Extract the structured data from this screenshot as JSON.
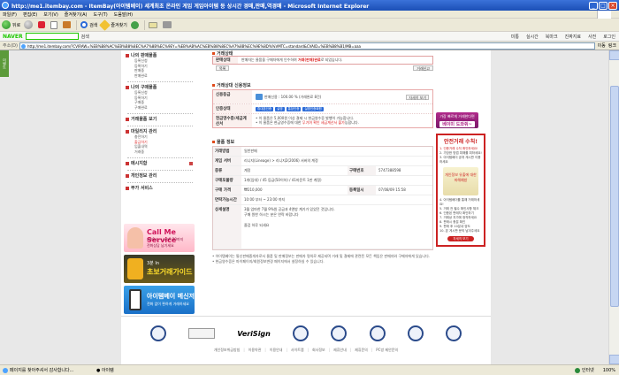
{
  "window": {
    "title": "http://me1.itembay.com - ItemBay(아이템베이) 세계최초 온라인 게임 게임아이템 등 상시간 경매,판매,역경매 - Microsoft Internet Explorer",
    "min": "_",
    "max": "□",
    "close": "×"
  },
  "menu": [
    "파일(F)",
    "편집(E)",
    "보기(V)",
    "즐겨찾기(A)",
    "도구(T)",
    "도움말(H)"
  ],
  "toolbar": {
    "back": "뒤로",
    "search": "검색",
    "favorites": "즐겨찾기"
  },
  "naver": {
    "logo": "NAVER",
    "search_btn": "검색",
    "items": [
      "미통",
      "실시간",
      "북마크",
      "진짜지료",
      "사전"
    ],
    "login": "로그인"
  },
  "address": {
    "label": "주소(D)",
    "url": "http://me1.itembay.com/?CVIRAW=%EB%B8%AC%EB%B8%8EC%A7%8B%EC%9EY=%EB%AB%AC%EB%B8%8EC%A7%8B%EC%9E%8D%%VMTC=standard&CVAID=%EB%B8%B1/MB=aaa",
    "go": "이동",
    "links": "링크"
  },
  "side_tab": "이벤트",
  "leftnav": {
    "groups": [
      {
        "head": "나의 판매물품",
        "items": [
          "등록신청",
          "등록하기",
          "판매중",
          "판매완료"
        ]
      },
      {
        "head": "나의 구매물품",
        "items": [
          "등록신청",
          "등록하기",
          "구매중",
          "구매완료"
        ]
      },
      {
        "head": "거래물품 보기"
      },
      {
        "head": "마일리지 관리",
        "items": [
          "충전하기",
          "출금하기",
          "입출내역",
          "거래중"
        ]
      },
      {
        "head": "메시지함"
      },
      {
        "head": "개인정보 관리"
      },
      {
        "head": "부가 서비스"
      }
    ],
    "selected_item": "출금하기"
  },
  "banners": {
    "callme": {
      "title": "Call Me Service",
      "line1": "am9시 ~ pm9:30까지",
      "line2": "전화상담 남기세요"
    },
    "guide": {
      "line1": "3분 In",
      "line2": "초보거래가이드"
    },
    "app": {
      "title": "아이템베이 메신저",
      "sub": "전화 없이 편하게 거래하세요"
    }
  },
  "trade_status": {
    "title": "거래상태",
    "key": "판매상태",
    "value_prefix": "판매자는 물품을 구매자에게 인수하여",
    "value_red": "거래(판매)완료",
    "value_suffix": "로 되었습니다.",
    "btn_left": "목록",
    "btn_right": "거래신고"
  },
  "credit": {
    "title": "거래상대 신용정보",
    "rows": [
      {
        "key": "신용등급",
        "value": "판매신용 : 100.00 % (거래완료 8건)",
        "pct": "100.00 %",
        "more": "자세히 보기"
      },
      {
        "key": "인증상태",
        "badges": [
          "휴대폰인증",
          "실명",
          "통장인증",
          "실명인증회원"
        ]
      },
      {
        "key": "현금영수증/세금계산서",
        "value1": "• 이 물품은 5,000원 이상 결제 시 현금영수증 발행이 가능합니다.",
        "value2": "• 이 물품은 현금영수증에 대한 ",
        "value2_red": "무기여 확인 세금계산서 불가",
        "value2_end": "능합니다."
      }
    ]
  },
  "product": {
    "title": "물품 정보",
    "rows": [
      {
        "key": "거래방법",
        "value": "일반판매"
      },
      {
        "key": "게임 서버",
        "value": "리니지(Lineage) > 리니지2(2006) 서버의 계정"
      },
      {
        "key": "종류",
        "value": "계정",
        "key2": "구매번호",
        "value2": "5747388598"
      },
      {
        "key": "구매포물량",
        "value": "1개(임대) / 45 등급(50이하) / 41마운트 1판 계정)"
      },
      {
        "key": "구매 가격",
        "value": "₩210,000",
        "key2": "등록일시",
        "value2": "07/08/09 15:58"
      },
      {
        "key": "연락가능시간",
        "value": "10:00 부터 ~ 23:00 까지"
      }
    ],
    "detail_key": "상세설명",
    "detail_lines": [
      "3월 엄마한 7월 9%원 공급과 4엔방 계기가 있었던 것입니다.",
      "구매 원한 하시는 분은 연락 바랍니다",
      "",
      "즐겁 하루 되세요"
    ]
  },
  "notes": [
    "• 아이템베이는 통신판매중개자로서 물품 및 판매정보는 판매자 명의로 제공되며 거래 및 결제에 관련된 모든 책임은 판매자와 구매자에게 있습니다.",
    "• 현금영수증은 마이페이지/회원정보변경 페이지에서 설정하실 수 있습니다."
  ],
  "rightcol": {
    "banner_line1": "가장 빠르게 거래한다면",
    "banner_big": "베이미 도와줘~",
    "safe_title": "안전거래 수칙!",
    "safe_items": [
      {
        "t": "1. 인증거래 수칙 확인하세요!",
        "red": true
      },
      {
        "t": "2. 가장한 방법 피해를 피하세요!",
        "red": false
      },
      {
        "t": "3. 아이템베이 공개 게시판 이용하세요",
        "red": false
      }
    ],
    "safe_pic": "개인정보 유출에 대한 피해예방",
    "safe_items2": [
      "4. 아이템베이를 통해 거래하세요!",
      "5. 거래 전 필수 확인사항 체크",
      "6. 인증된 판매자 확인하기",
      "7. 거래상 지가에 정직하세요",
      "8. 판매시 충분 확인",
      "9. 판매 후 10분내 양도",
      "10. 본 게시판 문의 남겨주세요"
    ],
    "safe_more": "자세히 보기"
  },
  "footer": {
    "logos": [
      "공정거래위원회",
      "한국인터넷진흥원",
      "VeriSign",
      "인증마크1",
      "인증마크2",
      "인증마크3",
      "인증마크4",
      "인증마크5"
    ],
    "verisign": "VeriSign",
    "links": [
      "개인정보취급방침",
      "이용약관",
      "이용안내",
      "사이트맵",
      "회사정보",
      "제휴안내",
      "제휴문의",
      "PC방 제안문의"
    ]
  },
  "status": {
    "msg": "페이지를 찾아주셔서 감사합니다...",
    "msg2": "● 아이템",
    "zone": "인터넷",
    "zoom": "100%"
  }
}
